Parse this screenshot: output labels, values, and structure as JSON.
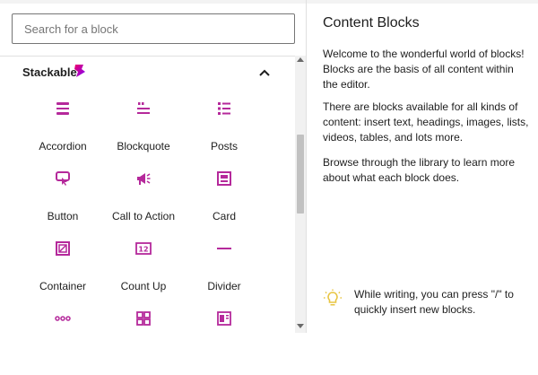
{
  "search": {
    "placeholder": "Search for a block"
  },
  "panel": {
    "title": "Stackable",
    "logo_icon": "stackable-logo-icon",
    "toggle_icon": "chevron-up-icon"
  },
  "colors": {
    "icon_magenta": "#b5299b",
    "logo_gradient_start": "#f00069",
    "logo_gradient_end": "#7c00ff",
    "tip_icon": "#e8c542"
  },
  "blocks": [
    {
      "label": "Accordion",
      "icon": "accordion-icon"
    },
    {
      "label": "Blockquote",
      "icon": "blockquote-icon"
    },
    {
      "label": "Posts",
      "icon": "posts-icon"
    },
    {
      "label": "Button",
      "icon": "button-icon"
    },
    {
      "label": "Call to Action",
      "icon": "call-to-action-icon"
    },
    {
      "label": "Card",
      "icon": "card-icon"
    },
    {
      "label": "Container",
      "icon": "container-icon"
    },
    {
      "label": "Count Up",
      "icon": "count-up-icon"
    },
    {
      "label": "Divider",
      "icon": "divider-icon"
    },
    {
      "label": "",
      "icon": "more-icon"
    },
    {
      "label": "",
      "icon": "feature-grid-icon"
    },
    {
      "label": "",
      "icon": "feature-icon"
    }
  ],
  "info": {
    "title": "Content Blocks",
    "paragraphs": [
      "Welcome to the wonderful world of blocks! Blocks are the basis of all content within the editor.",
      "There are blocks available for all kinds of content: insert text, headings, images, lists, videos, tables, and lots more.",
      "Browse through the library to learn more about what each block does."
    ]
  },
  "tip": {
    "text": "While writing, you can press \"/\" to quickly insert new blocks.",
    "icon": "lightbulb-icon"
  }
}
